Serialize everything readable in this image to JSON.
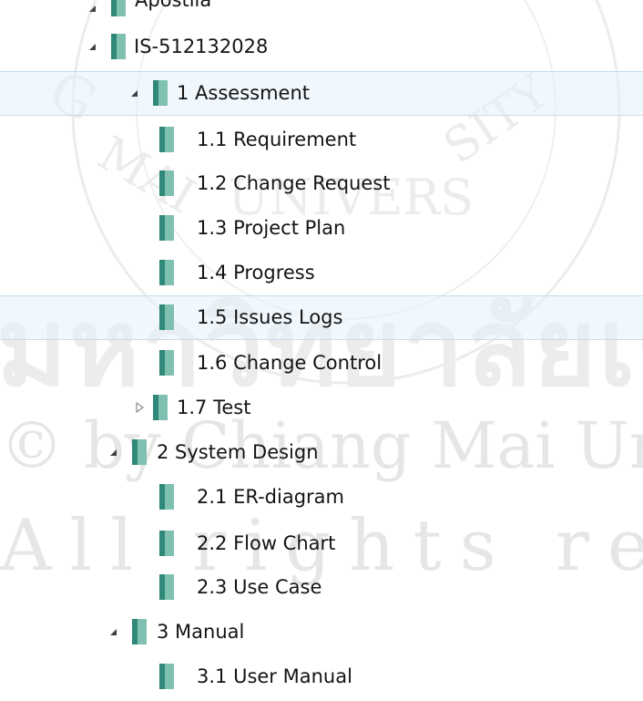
{
  "tree": {
    "partial_top_label": "Apostila",
    "root": {
      "label": "IS-512132028",
      "expanded": true,
      "children": [
        {
          "label": "1 Assessment",
          "expanded": true,
          "children": [
            {
              "label": "1.1 Requirement"
            },
            {
              "label": "1.2 Change Request"
            },
            {
              "label": "1.3 Project Plan"
            },
            {
              "label": "1.4 Progress"
            },
            {
              "label": "1.5 Issues Logs",
              "hovered": true
            },
            {
              "label": "1.6 Change Control"
            },
            {
              "label": "1.7 Test",
              "expanded": false,
              "has_children": true
            }
          ]
        },
        {
          "label": "2 System Design",
          "expanded": true,
          "children": [
            {
              "label": "2.1 ER-diagram"
            },
            {
              "label": "2.2 Flow Chart"
            },
            {
              "label": "2.3 Use Case"
            }
          ]
        },
        {
          "label": "3 Manual",
          "expanded": true,
          "children": [
            {
              "label": "3.1 User Manual"
            }
          ]
        }
      ]
    }
  },
  "watermark": {
    "line1": "มหาวิทยาลัยเชียงใหม่",
    "line2": "© by Chiang Mai University",
    "line3": "All rights reserved"
  },
  "colors": {
    "folder_light": "#7fc0b0",
    "folder_dark": "#2f8878",
    "hover_bg": "#e5f3fb",
    "hover_border": "#c3dcee",
    "text": "#141414"
  }
}
